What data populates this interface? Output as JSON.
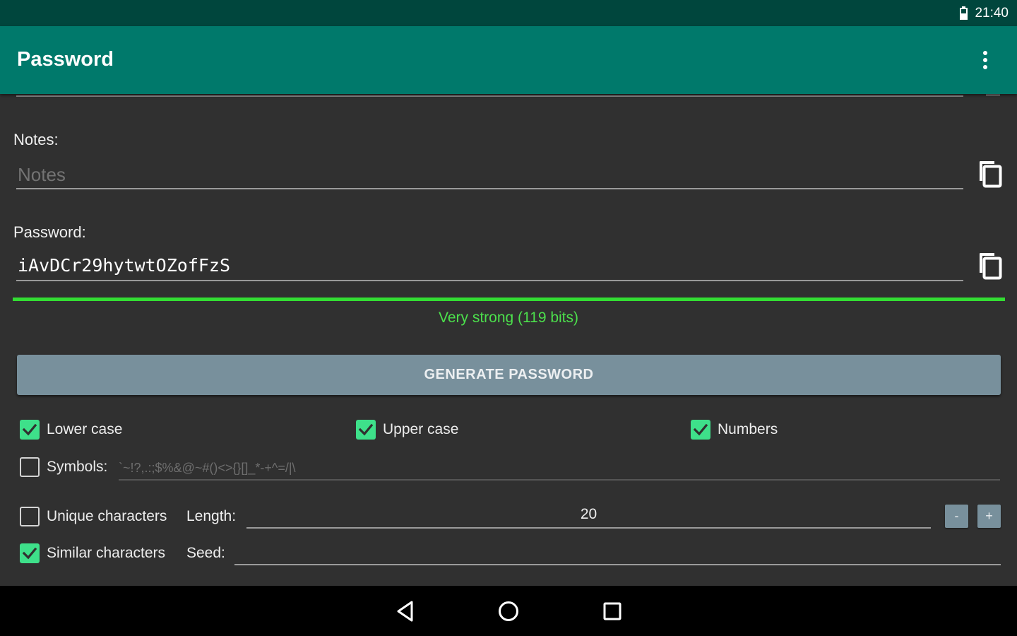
{
  "status_bar": {
    "time": "21:40"
  },
  "app_bar": {
    "title": "Password"
  },
  "notes": {
    "label": "Notes:",
    "placeholder": "Notes"
  },
  "password": {
    "label": "Password:",
    "value": "iAvDCr29hytwtOZofFzS"
  },
  "strength": {
    "text": "Very strong (119 bits)",
    "fill_percent": 100,
    "color": "#33dd33"
  },
  "generate_button": {
    "label": "GENERATE PASSWORD"
  },
  "options": {
    "lower_case": {
      "label": "Lower case",
      "checked": true
    },
    "upper_case": {
      "label": "Upper case",
      "checked": true
    },
    "numbers": {
      "label": "Numbers",
      "checked": true
    },
    "symbols": {
      "label": "Symbols:",
      "checked": false,
      "placeholder": "`~!?,.:;$%&@~#()<>{}[]_*-+^=/|\\"
    },
    "unique_characters": {
      "label": "Unique characters",
      "checked": false
    },
    "similar_characters": {
      "label": "Similar characters",
      "checked": true
    }
  },
  "length": {
    "label": "Length:",
    "value": "20",
    "minus_label": "-",
    "plus_label": "+"
  },
  "seed": {
    "label": "Seed:",
    "value": ""
  },
  "colors": {
    "accent": "#00796b",
    "status_bar": "#00463d",
    "checkbox": "#3ee08a",
    "button": "#78909c"
  },
  "icons": [
    "battery-icon",
    "overflow-menu-icon",
    "copy-icon",
    "check-icon",
    "back-icon",
    "home-icon",
    "recents-icon"
  ]
}
